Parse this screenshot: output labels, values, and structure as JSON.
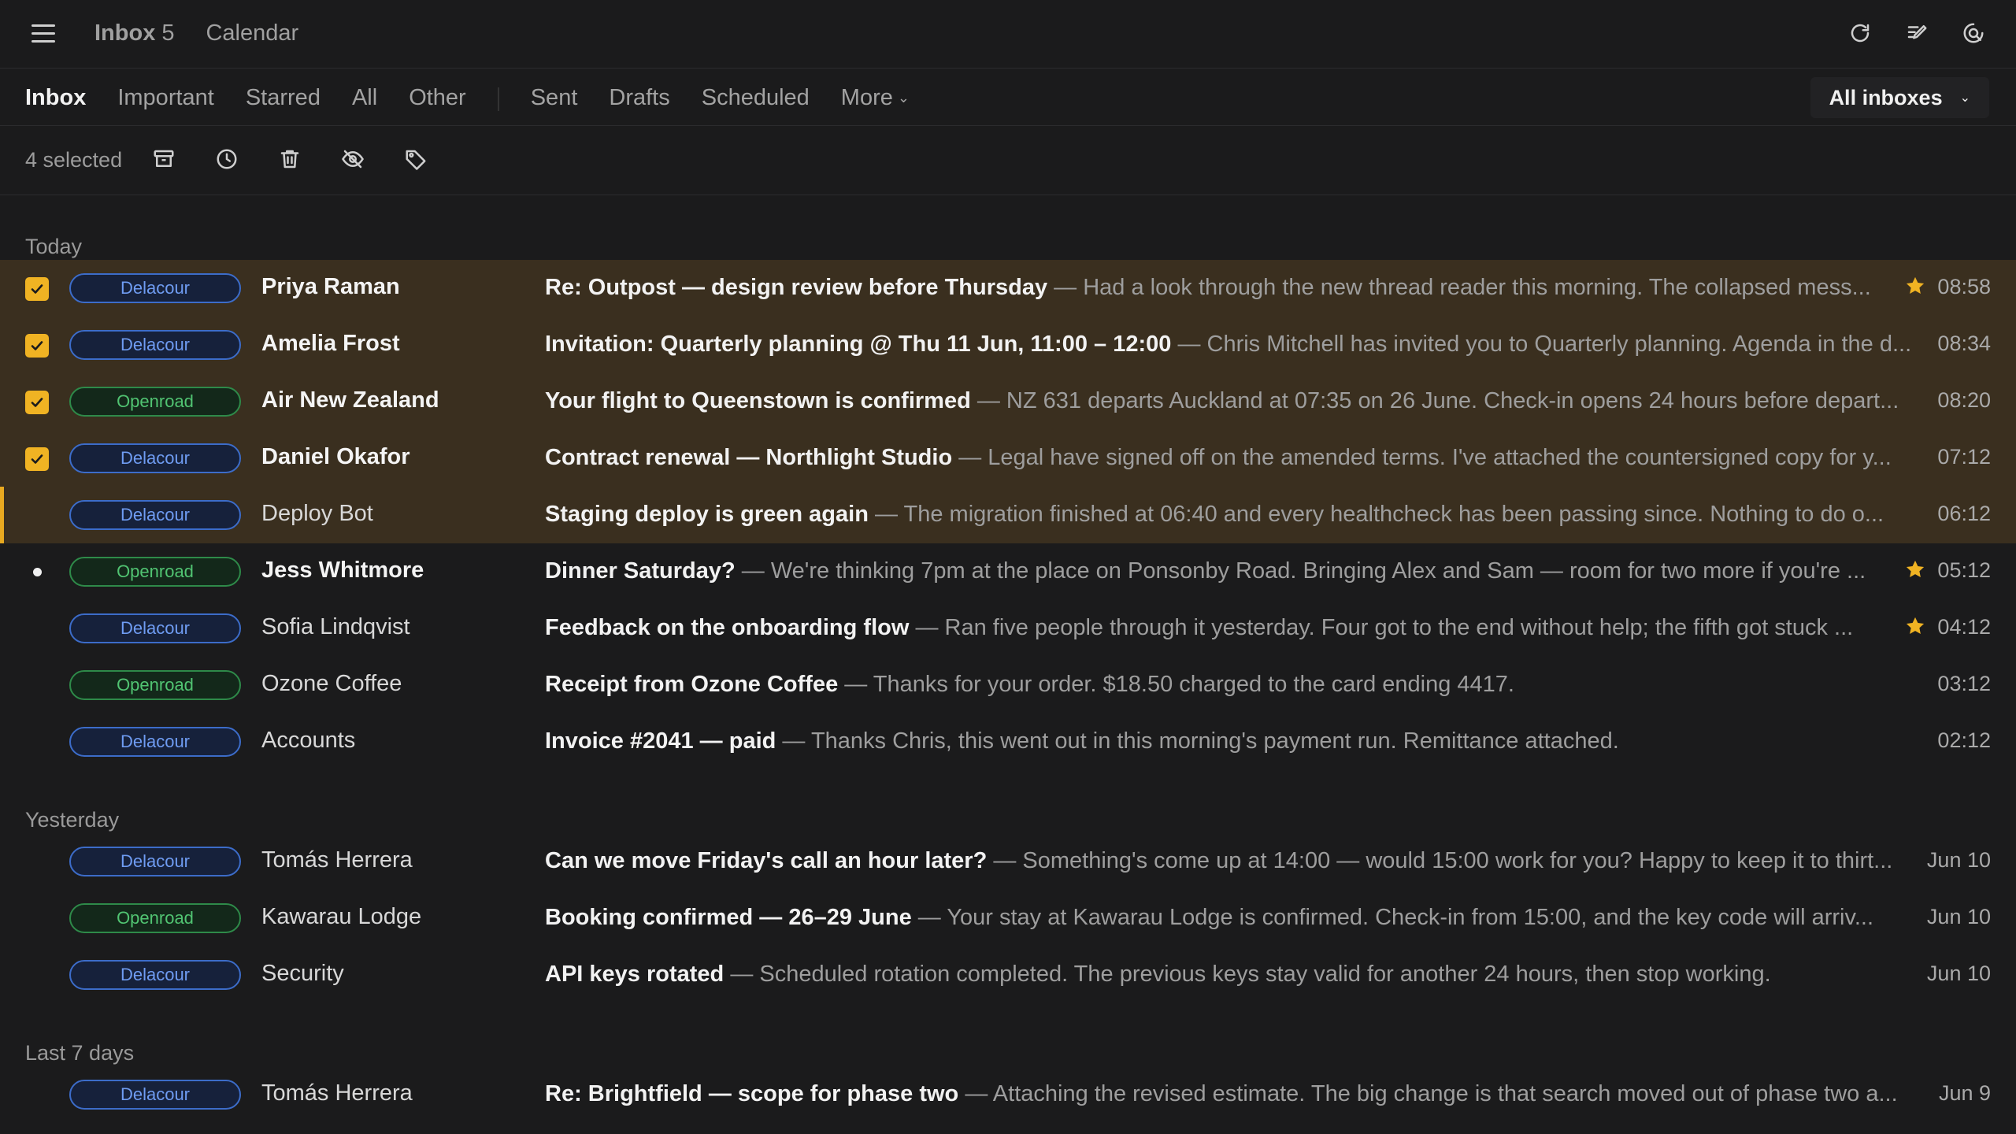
{
  "topbar": {
    "inbox_label": "Inbox",
    "inbox_count": "5",
    "calendar_label": "Calendar",
    "icons": [
      "refresh-icon",
      "compose-icon",
      "account-search-icon"
    ]
  },
  "tabs": [
    "Inbox",
    "Important",
    "Starred",
    "All",
    "Other"
  ],
  "folders": [
    "Sent",
    "Drafts",
    "Scheduled"
  ],
  "more_label": "More",
  "inbox_selector": "All inboxes",
  "actionbar": {
    "selected_text": "4 selected",
    "icons": [
      "archive-icon",
      "snooze-clock-icon",
      "trash-icon",
      "mark-unread-eye-off-icon",
      "label-tag-icon"
    ]
  },
  "colors": {
    "accent": "#f0b323",
    "selected_row": "#3a2f1f",
    "tag_blue": "#6f9cf2",
    "tag_green": "#51c472"
  },
  "groups": [
    {
      "label": "Today",
      "emails": [
        {
          "tag": "Delacour",
          "tag_color": "blue",
          "sender": "Priya Raman",
          "subject": "Re: Outpost — design review before Thursday",
          "preview": " — Had a look through the new thread reader this morning. The collapsed mess...",
          "time": "08:58",
          "starred": true,
          "selected": true,
          "unread": true
        },
        {
          "tag": "Delacour",
          "tag_color": "blue",
          "sender": "Amelia Frost",
          "subject": "Invitation: Quarterly planning @ Thu 11 Jun, 11:00 – 12:00",
          "preview": " — Chris Mitchell has invited you to Quarterly planning. Agenda in the d...",
          "time": "08:34",
          "starred": false,
          "selected": true,
          "unread": true
        },
        {
          "tag": "Openroad",
          "tag_color": "green",
          "sender": "Air New Zealand",
          "subject": "Your flight to Queenstown is confirmed",
          "preview": " — NZ 631 departs Auckland at 07:35 on 26 June. Check-in opens 24 hours before depart...",
          "time": "08:20",
          "starred": false,
          "selected": true,
          "unread": true
        },
        {
          "tag": "Delacour",
          "tag_color": "blue",
          "sender": "Daniel Okafor",
          "subject": "Contract renewal — Northlight Studio",
          "preview": " — Legal have signed off on the amended terms. I've attached the countersigned copy for y...",
          "time": "07:12",
          "starred": false,
          "selected": true,
          "unread": true
        },
        {
          "tag": "Delacour",
          "tag_color": "blue",
          "sender": "Deploy Bot",
          "subject": "Staging deploy is green again",
          "preview": " — The migration finished at 06:40 and every healthcheck has been passing since. Nothing to do o...",
          "time": "06:12",
          "starred": false,
          "selected": false,
          "focused": true,
          "unread": false
        },
        {
          "tag": "Openroad",
          "tag_color": "green",
          "sender": "Jess Whitmore",
          "subject": "Dinner Saturday?",
          "preview": " — We're thinking 7pm at the place on Ponsonby Road. Bringing Alex and Sam — room for two more if you're ...",
          "time": "05:12",
          "starred": true,
          "selected": false,
          "unread": true,
          "dot": true
        },
        {
          "tag": "Delacour",
          "tag_color": "blue",
          "sender": "Sofia Lindqvist",
          "subject": "Feedback on the onboarding flow",
          "preview": " — Ran five people through it yesterday. Four got to the end without help; the fifth got stuck ...",
          "time": "04:12",
          "starred": true,
          "selected": false,
          "unread": false
        },
        {
          "tag": "Openroad",
          "tag_color": "green",
          "sender": "Ozone Coffee",
          "subject": "Receipt from Ozone Coffee",
          "preview": " — Thanks for your order. $18.50 charged to the card ending 4417.",
          "time": "03:12",
          "starred": false,
          "selected": false,
          "unread": false
        },
        {
          "tag": "Delacour",
          "tag_color": "blue",
          "sender": "Accounts",
          "subject": "Invoice #2041 — paid",
          "preview": " — Thanks Chris, this went out in this morning's payment run. Remittance attached.",
          "time": "02:12",
          "starred": false,
          "selected": false,
          "unread": false
        }
      ]
    },
    {
      "label": "Yesterday",
      "emails": [
        {
          "tag": "Delacour",
          "tag_color": "blue",
          "sender": "Tomás Herrera",
          "subject": "Can we move Friday's call an hour later?",
          "preview": " — Something's come up at 14:00 — would 15:00 work for you? Happy to keep it to thirt...",
          "time": "Jun 10",
          "starred": false,
          "selected": false,
          "unread": false
        },
        {
          "tag": "Openroad",
          "tag_color": "green",
          "sender": "Kawarau Lodge",
          "subject": "Booking confirmed — 26–29 June",
          "preview": " — Your stay at Kawarau Lodge is confirmed. Check-in from 15:00, and the key code will arriv...",
          "time": "Jun 10",
          "starred": false,
          "selected": false,
          "unread": false
        },
        {
          "tag": "Delacour",
          "tag_color": "blue",
          "sender": "Security",
          "subject": "API keys rotated",
          "preview": " — Scheduled rotation completed. The previous keys stay valid for another 24 hours, then stop working.",
          "time": "Jun 10",
          "starred": false,
          "selected": false,
          "unread": false
        }
      ]
    },
    {
      "label": "Last 7 days",
      "emails": [
        {
          "tag": "Delacour",
          "tag_color": "blue",
          "sender": "Tomás Herrera",
          "subject": "Re: Brightfield — scope for phase two",
          "preview": " — Attaching the revised estimate. The big change is that search moved out of phase two a...",
          "time": "Jun 9",
          "starred": false,
          "selected": false,
          "unread": false
        }
      ]
    }
  ]
}
